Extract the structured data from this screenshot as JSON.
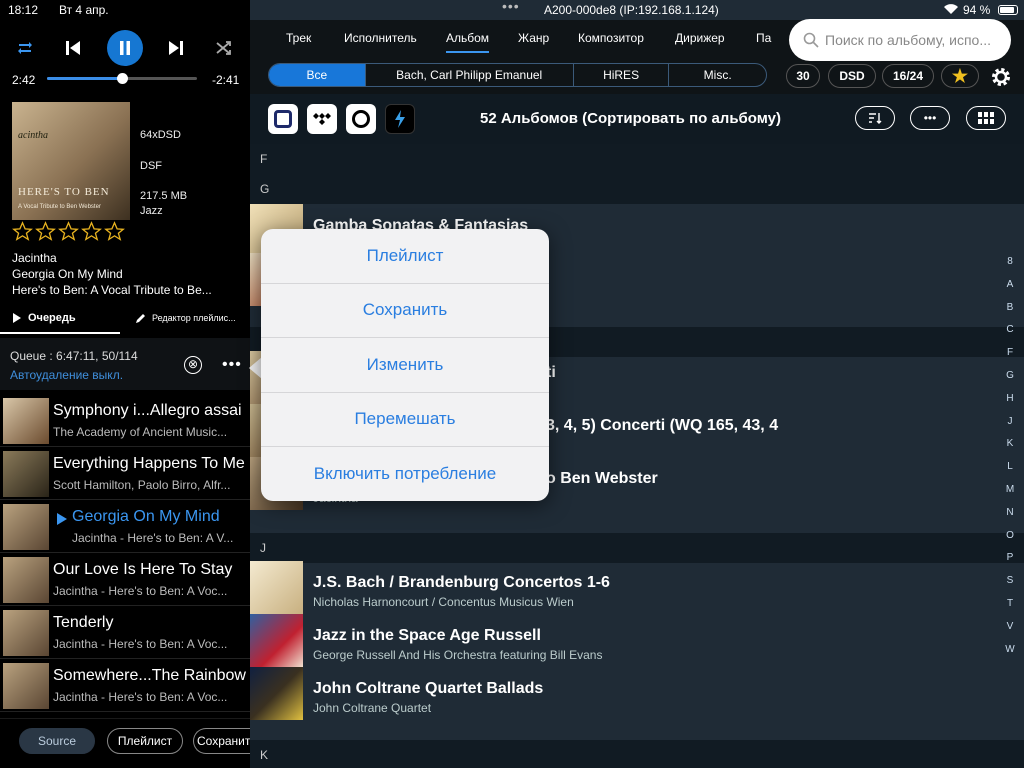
{
  "status": {
    "time": "18:12",
    "date": "Вт 4 апр.",
    "device": "A200-000de8 (IP:192.168.1.124)",
    "battery": "94 %"
  },
  "player": {
    "elapsed": "2:42",
    "remaining": "-2:41",
    "progress": 0.5
  },
  "track": {
    "format": "64xDSD",
    "type": "DSF",
    "size": "217.5 MB",
    "genre": "Jazz",
    "artist": "Jacintha",
    "title": "Georgia On My Mind",
    "album": "Here's to Ben: A Vocal Tribute to Be...",
    "rating": 0
  },
  "cover": {
    "name": "acintha",
    "big_text": "HERE'S TO BEN",
    "small_text": "A Vocal Tribute to Ben Webster"
  },
  "queue_tabs": {
    "queue": "Очередь",
    "editor": "Редактор плейлис..."
  },
  "queue": {
    "summary": "Queue :  6:47:11, 50/114",
    "auto_delete": "Автоудаление выкл.",
    "close_icon": "⊗",
    "more": "•••",
    "items": [
      {
        "title": "Symphony i...Allegro assai",
        "subtitle": "The Academy of Ancient Music..."
      },
      {
        "title": "Everything Happens To Me",
        "subtitle": "Scott Hamilton, Paolo Birro, Alfr..."
      },
      {
        "title": "Georgia On My Mind",
        "subtitle": "Jacintha - Here's to Ben: A V..."
      },
      {
        "title": "Our Love Is Here To Stay",
        "subtitle": "Jacintha - Here's to Ben: A Voc..."
      },
      {
        "title": "Tenderly",
        "subtitle": "Jacintha - Here's to Ben: A Voc..."
      },
      {
        "title": "Somewhere...The Rainbow",
        "subtitle": "Jacintha - Here's to Ben: A Voc..."
      }
    ]
  },
  "bottom": {
    "source": "Source",
    "playlist": "Плейлист",
    "save": "Сохранит"
  },
  "nav": {
    "items": [
      "Трек",
      "Исполнитель",
      "Альбом",
      "Жанр",
      "Композитор",
      "Дирижер",
      "Па"
    ],
    "active": "Альбом"
  },
  "search": {
    "placeholder": "Поиск по альбому, испо..."
  },
  "filters": {
    "segments": [
      "Все",
      "Bach, Carl Philipp Emanuel",
      "HiRES",
      "Misc."
    ],
    "active": "Все",
    "b30": "30",
    "dsd": "DSD",
    "res": "16/24",
    "star": "★"
  },
  "header": {
    "title": "52 Альбомов (Сортировать по альбому)",
    "more": "•••"
  },
  "sections": {
    "f": "F",
    "g": "G",
    "j": "J",
    "k": "K"
  },
  "albums": [
    {
      "title": "Gamba Sonatas & Fantasias",
      "subtitle": ""
    },
    {
      "title": "ti",
      "subtitle": ""
    },
    {
      "title": "3, 4, 5) Concerti (WQ 165, 43, 4",
      "subtitle": ""
    },
    {
      "title": "o Ben Webster",
      "subtitle": "Jacintha"
    },
    {
      "title": "J.S. Bach / Brandenburg Concertos 1-6",
      "subtitle": "Nicholas Harnoncourt / Concentus Musicus Wien"
    },
    {
      "title": "Jazz in the Space Age Russell",
      "subtitle": "George Russell And His Orchestra featuring Bill Evans"
    },
    {
      "title": "John Coltrane Quartet Ballads",
      "subtitle": "John Coltrane Quartet"
    }
  ],
  "alphabet": [
    "8",
    "A",
    "B",
    "C",
    "F",
    "G",
    "H",
    "J",
    "K",
    "L",
    "M",
    "N",
    "O",
    "P",
    "S",
    "T",
    "V",
    "W"
  ],
  "popover": {
    "items": [
      "Плейлист",
      "Сохранить",
      "Изменить",
      "Перемешать",
      "Включить потребление"
    ]
  },
  "colors": {
    "accent": "#1677d2",
    "link": "#2a7ee0",
    "background": "#1f2b36"
  }
}
